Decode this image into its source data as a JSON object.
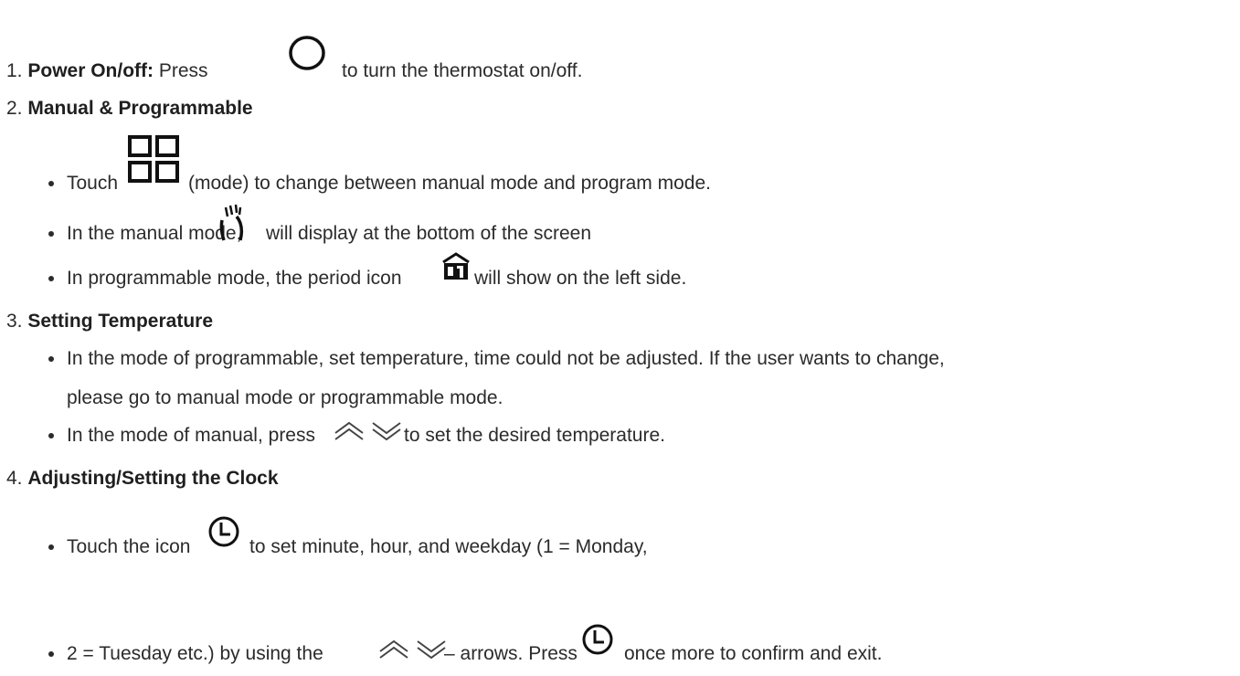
{
  "items": [
    {
      "number": "1.",
      "title": "Power On/off:",
      "pre": "Press",
      "post": "to turn the thermostat on/off.",
      "icon": "power-circle-icon"
    },
    {
      "number": "2.",
      "title": "Manual & Programmable",
      "bullets": [
        {
          "pre": "Touch",
          "post": "(mode) to change between manual mode and program mode.",
          "icon": "mode-grid-icon"
        },
        {
          "pre": "In the manual mode,",
          "post": "will display at the bottom of the screen",
          "icon": "hand-icon"
        },
        {
          "pre": "In programmable mode, the period icon",
          "post": "will show on the left side.",
          "icon": "period-home-icon"
        }
      ]
    },
    {
      "number": "3.",
      "title": "Setting Temperature",
      "bullets": [
        {
          "line1": "In the mode of programmable, set temperature, time could not be adjusted. If the user wants to change,",
          "line2": "please go to manual mode or programmable mode."
        },
        {
          "pre": "In the mode of manual, press",
          "post": "to set the desired temperature.",
          "icon": "up-down-chevrons-icon"
        }
      ]
    },
    {
      "number": "4.",
      "title": "Adjusting/Setting the Clock",
      "bullets": [
        {
          "pre": "Touch the icon",
          "post": "to set minute, hour, and weekday (1 = Monday,",
          "icon": "clock-icon"
        },
        {
          "pre": "2 = Tuesday etc.) by using the",
          "mid": "– arrows. Press",
          "post": "once more to confirm and exit.",
          "icon": "up-down-chevrons-icon",
          "icon2": "clock-icon"
        }
      ]
    }
  ]
}
